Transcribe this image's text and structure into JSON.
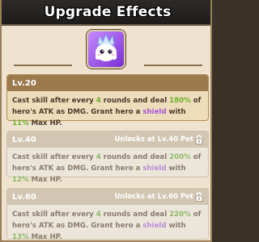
{
  "header": {
    "title": "Upgrade Effects"
  },
  "skill": {
    "icon": "crowned-ghost-skill-icon"
  },
  "levels": [
    {
      "label": "Lv.20",
      "unlocked": true,
      "unlock_text": "",
      "desc": {
        "p1": "Cast skill after every ",
        "rounds": "4",
        "p2": " rounds and deal ",
        "pct": "180%",
        "p3": " of hero's ATK as DMG. Grant hero a ",
        "shield": "shield",
        "p4": " with ",
        "hp": "11%",
        "p5": " Max HP."
      }
    },
    {
      "label": "Lv.40",
      "unlocked": false,
      "unlock_text": "Unlocks at Lv.40 Pet",
      "desc": {
        "p1": "Cast skill after every ",
        "rounds": "4",
        "p2": " rounds and deal ",
        "pct": "200%",
        "p3": " of hero's ATK as DMG. Grant hero a ",
        "shield": "shield",
        "p4": " with ",
        "hp": "12%",
        "p5": " Max HP."
      }
    },
    {
      "label": "Lv.60",
      "unlocked": false,
      "unlock_text": "Unlocks at Lv.60 Pet",
      "desc": {
        "p1": "Cast skill after every ",
        "rounds": "4",
        "p2": " rounds and deal ",
        "pct": "220%",
        "p3": " of hero's ATK as DMG. Grant hero a ",
        "shield": "shield",
        "p4": " with ",
        "hp": "13%",
        "p5": " Max HP."
      }
    }
  ],
  "colors": {
    "highlight_green": "#6bb12b",
    "highlight_purple": "#a657d9",
    "active_header": "#9c7a4e",
    "locked_header": "#d2c6b2"
  }
}
